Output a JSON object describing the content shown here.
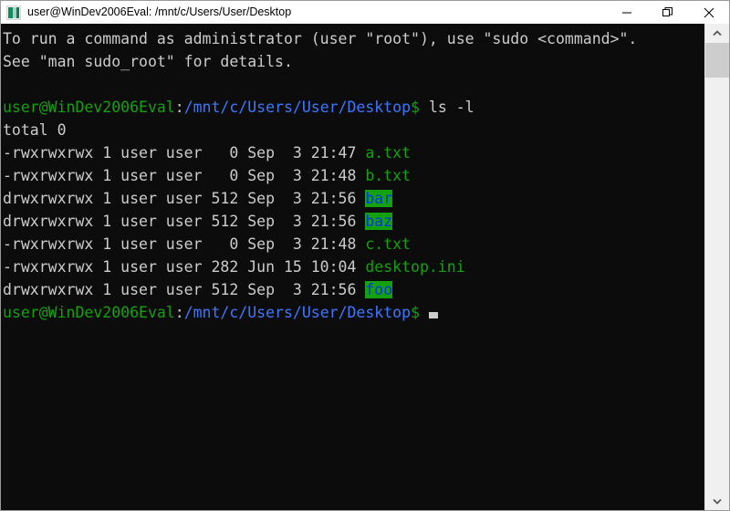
{
  "window": {
    "title": "user@WinDev2006Eval: /mnt/c/Users/User/Desktop",
    "icon": "terminal-icon",
    "background_color": "#0c0c0c",
    "foreground_color": "#cccccc",
    "controls": {
      "minimize": "–",
      "restore": "❐",
      "close": "✕"
    }
  },
  "colors": {
    "prompt_user": "#13a10e",
    "prompt_path": "#3b78ff",
    "file_green": "#13a10e",
    "dir_text": "#0037da",
    "dir_background": "#13a10e",
    "text": "#cccccc",
    "terminal_bg": "#0c0c0c",
    "titlebar_bg": "#ffffff",
    "scrollbar_track": "#f0f0f0",
    "scrollbar_thumb": "#cdcdcd"
  },
  "terminal": {
    "motd": [
      "To run a command as administrator (user \"root\"), use \"sudo <command>\".",
      "See \"man sudo_root\" for details."
    ],
    "prompt": {
      "user_host": "user@WinDev2006Eval",
      "separator": ":",
      "path": "/mnt/c/Users/User/Desktop",
      "sigil": "$"
    },
    "command": " ls -l",
    "total_line": "total 0",
    "listing": [
      {
        "perms": "-rwxrwxrwx",
        "links": "1",
        "owner": "user",
        "group": "user",
        "size": "0",
        "month": "Sep",
        "day": "3",
        "time": "21:47",
        "name": "a.txt",
        "kind": "file"
      },
      {
        "perms": "-rwxrwxrwx",
        "links": "1",
        "owner": "user",
        "group": "user",
        "size": "0",
        "month": "Sep",
        "day": "3",
        "time": "21:48",
        "name": "b.txt",
        "kind": "file"
      },
      {
        "perms": "drwxrwxrwx",
        "links": "1",
        "owner": "user",
        "group": "user",
        "size": "512",
        "month": "Sep",
        "day": "3",
        "time": "21:56",
        "name": "bar",
        "kind": "dir"
      },
      {
        "perms": "drwxrwxrwx",
        "links": "1",
        "owner": "user",
        "group": "user",
        "size": "512",
        "month": "Sep",
        "day": "3",
        "time": "21:56",
        "name": "baz",
        "kind": "dir"
      },
      {
        "perms": "-rwxrwxrwx",
        "links": "1",
        "owner": "user",
        "group": "user",
        "size": "0",
        "month": "Sep",
        "day": "3",
        "time": "21:48",
        "name": "c.txt",
        "kind": "file"
      },
      {
        "perms": "-rwxrwxrwx",
        "links": "1",
        "owner": "user",
        "group": "user",
        "size": "282",
        "month": "Jun",
        "day": "15",
        "time": "10:04",
        "name": "desktop.ini",
        "kind": "file"
      },
      {
        "perms": "drwxrwxrwx",
        "links": "1",
        "owner": "user",
        "group": "user",
        "size": "512",
        "month": "Sep",
        "day": "3",
        "time": "21:56",
        "name": "foo",
        "kind": "dir"
      }
    ]
  },
  "scrollbar": {
    "up_arrow": "▲",
    "down_arrow": "▼"
  }
}
